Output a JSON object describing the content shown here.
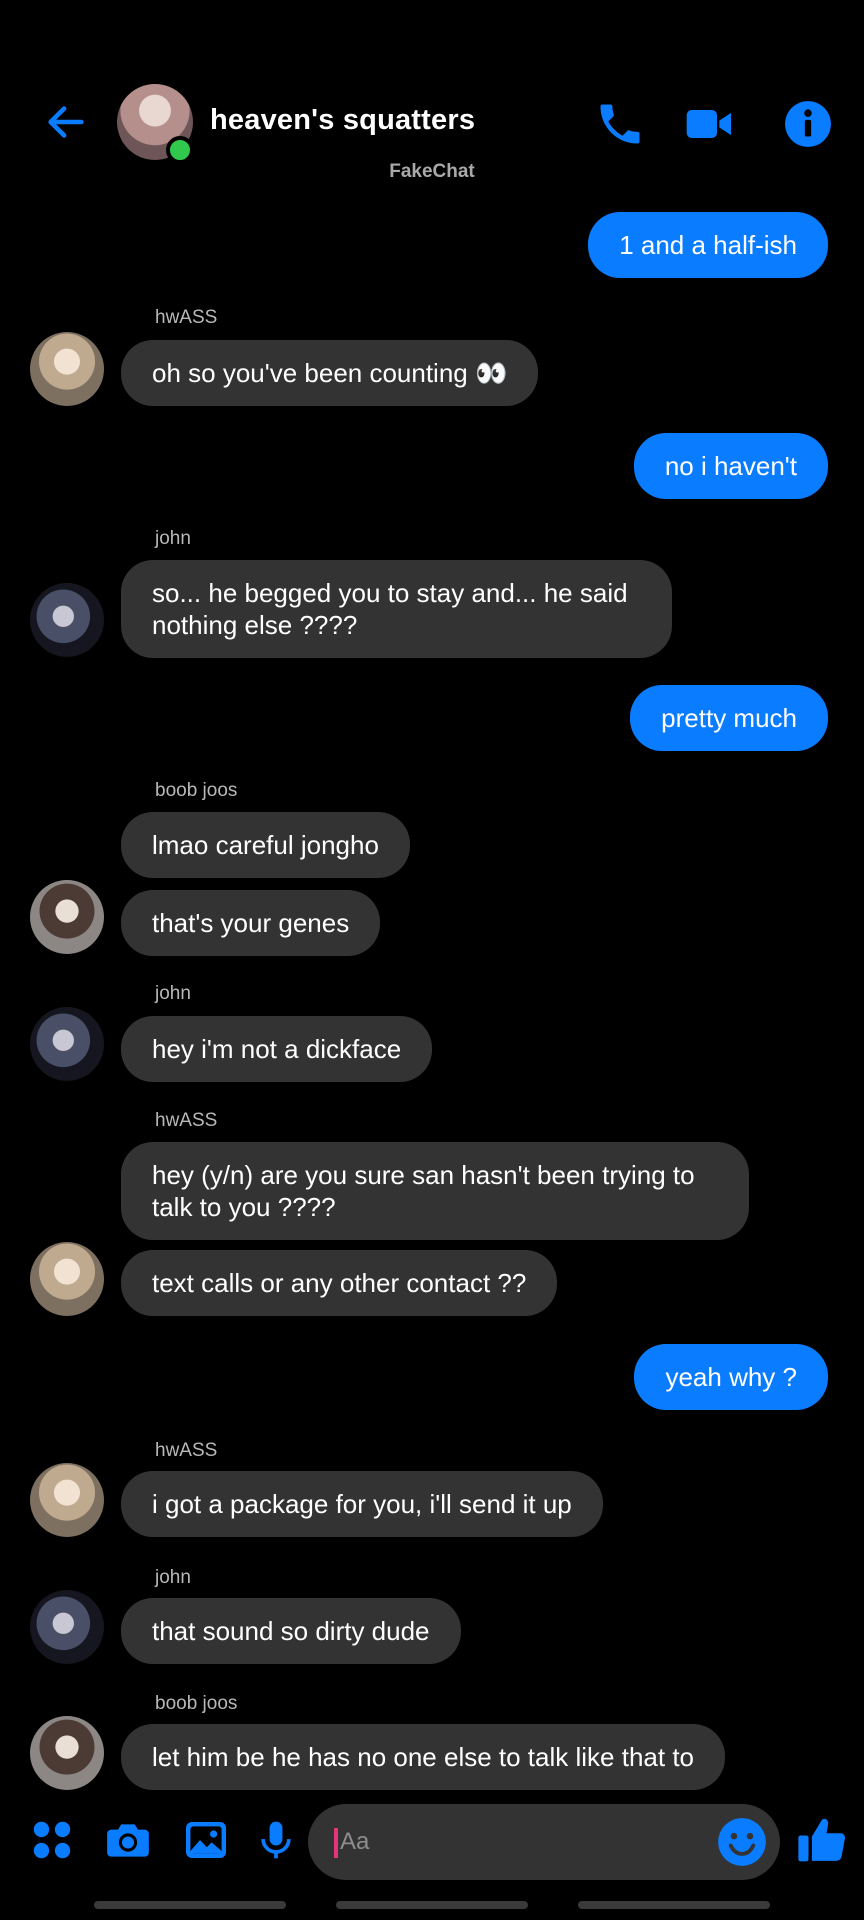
{
  "header": {
    "title": "heaven's squatters",
    "watermark": "FakeChat",
    "online": true
  },
  "colors": {
    "accent": "#0a7cff",
    "background": "#000000",
    "incoming_bubble": "#333333",
    "online": "#31c94d"
  },
  "icons": {
    "back": "back-arrow-icon",
    "call": "phone-icon",
    "video": "video-camera-icon",
    "info": "info-icon",
    "apps": "grid-dots-icon",
    "camera": "camera-icon",
    "gallery": "image-icon",
    "mic": "microphone-icon",
    "emoji": "smiley-icon",
    "like": "thumbs-up-icon"
  },
  "messages": [
    {
      "direction": "out",
      "text": "1 and a half-ish"
    },
    {
      "direction": "in",
      "sender": "hwASS",
      "text": "oh so you've been counting 👀"
    },
    {
      "direction": "out",
      "text": "no i haven't"
    },
    {
      "direction": "in",
      "sender": "john",
      "text": "so... he begged you to stay and... he said nothing else ????"
    },
    {
      "direction": "out",
      "text": "pretty much"
    },
    {
      "direction": "in",
      "sender": "boob joos",
      "text": "lmao careful jongho"
    },
    {
      "direction": "in",
      "text": "that's your genes"
    },
    {
      "direction": "in",
      "sender": "john",
      "text": "hey i'm not a dickface"
    },
    {
      "direction": "in",
      "sender": "hwASS",
      "text": "hey (y/n) are you sure san hasn't been trying to talk to you ????"
    },
    {
      "direction": "in",
      "text": "text calls or any other contact ??"
    },
    {
      "direction": "out",
      "text": "yeah why ?"
    },
    {
      "direction": "in",
      "sender": "hwASS",
      "text": "i got a package for you, i'll send it up"
    },
    {
      "direction": "in",
      "sender": "john",
      "text": "that sound so dirty dude"
    },
    {
      "direction": "in",
      "sender": "boob joos",
      "text": "let him be he has no one else to talk like that to"
    }
  ],
  "composer": {
    "placeholder": "Aa",
    "value": ""
  }
}
